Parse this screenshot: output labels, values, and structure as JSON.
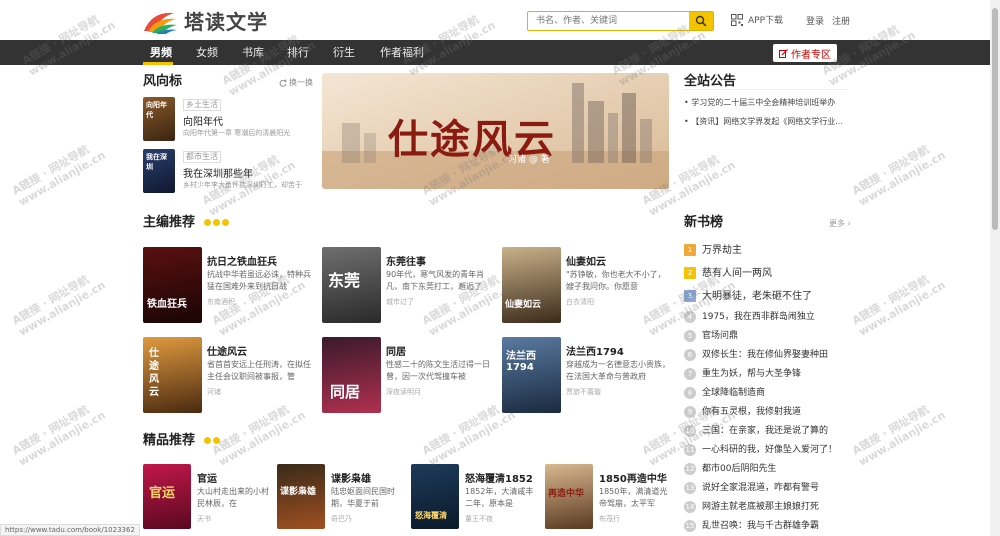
{
  "header": {
    "logo_text": "塔读文学",
    "search_placeholder": "书名、作者、关键词",
    "app_download": "APP下载",
    "login": "登录",
    "register": "注册"
  },
  "nav": {
    "items": [
      "男频",
      "女频",
      "书库",
      "排行",
      "衍生",
      "作者福利"
    ],
    "active": "男频",
    "author_zone": "作者专区"
  },
  "wind": {
    "title": "风向标",
    "refresh": "换一换",
    "items": [
      {
        "tag": "乡土生活",
        "name": "向阳年代",
        "desc": "向阳年代第一章 寒潮后的清晨阳光"
      },
      {
        "tag": "都市生活",
        "name": "我在深圳那些年",
        "desc": "乡村少年李大勇怀揣深圳打工，却苦于"
      }
    ]
  },
  "banner": {
    "title": "仕途风云",
    "author": "河诸 @ 著"
  },
  "announcements": {
    "title": "全站公告",
    "items": [
      "学习党的二十届三中全会精神培训班举办",
      "【资讯】网络文学界发起《网络文学行业..."
    ]
  },
  "editor_picks": {
    "title": "主编推荐",
    "books": [
      {
        "name": "抗日之铁血狂兵",
        "desc": "抗战中华若虽远必诛，特种兵猛在国难外来到抗日战",
        "author": "东南酒积",
        "cover_text": "铁血狂兵"
      },
      {
        "name": "东莞往事",
        "desc": "90年代，寒气风发的青年肖凡，南下东莞打工，邂逅了",
        "author": "城市过了",
        "cover_text": "东莞"
      },
      {
        "name": "仙妻如云",
        "desc": "\"苏铮敏，你也老大不小了，嫂子我问你。你愿意",
        "author": "白衣清阳",
        "cover_text": "仙妻如云"
      },
      {
        "name": "仕途风云",
        "desc": "省首首安远上任刑涛，在拟任主任会议职间被事报，管",
        "author": "河诸",
        "cover_text": "仕途风云"
      },
      {
        "name": "同居",
        "desc": "性感二十的陈文生活过得一日曾，因一次代驾撞车被",
        "author": "深夜读明月",
        "cover_text": "同居"
      },
      {
        "name": "法兰西1794",
        "desc": "穿越成为一名德意志小贵族，在法国大革命与普政府",
        "author": "贾旅不置璇",
        "cover_text": "法兰西 1794"
      }
    ]
  },
  "quality_picks": {
    "title": "精品推荐",
    "books": [
      {
        "name": "官运",
        "desc": "大山村走出来的小村民林辰，在",
        "author": "天书",
        "cover_text": "官运"
      },
      {
        "name": "谍影枭雄",
        "desc": "陆忠妪面间民国时期，华夏于前",
        "author": "奇巴乃",
        "cover_text": "谍影枭雄"
      },
      {
        "name": "怒海覆清1852",
        "desc": "1852年，大清咸丰二年，原本是",
        "author": "董王不夜",
        "cover_text": "怒海覆清"
      },
      {
        "name": "1850再造中华",
        "desc": "1850年，满清道光帝驾崩，太平军",
        "author": "布茂行",
        "cover_text": "再造中华"
      }
    ]
  },
  "new_books": {
    "title": "新书榜",
    "more": "更多",
    "items": [
      "万界劫主",
      "慈有人间一两风",
      "大明暴徒，老朱砸不住了",
      "1975，我在西非群岛闹独立",
      "官场问鼎",
      "双修长生：我在修仙界娶妻种田",
      "重生为妖，帮与大圣争锋",
      "全球降临制造商",
      "你有五灵根，我修射我道",
      "三国：在亲家，我还是说了算的",
      "一心科研的我，好像坠入爱河了！",
      "都市00后阴阳先生",
      "说好全家混混道，咋都有警号",
      "网游主就老底被那主娘娘打死",
      "乱世召唤：我与千古群雄争霸"
    ]
  },
  "status_link": "https://www.tadu.com/book/1023362",
  "watermark": {
    "line1": "A链接 · 网址导航",
    "line2": "www.alianjie.cn"
  },
  "colors": {
    "accent": "#f5c400",
    "nav_bg": "#333333",
    "author_btn": "#cc0000"
  }
}
